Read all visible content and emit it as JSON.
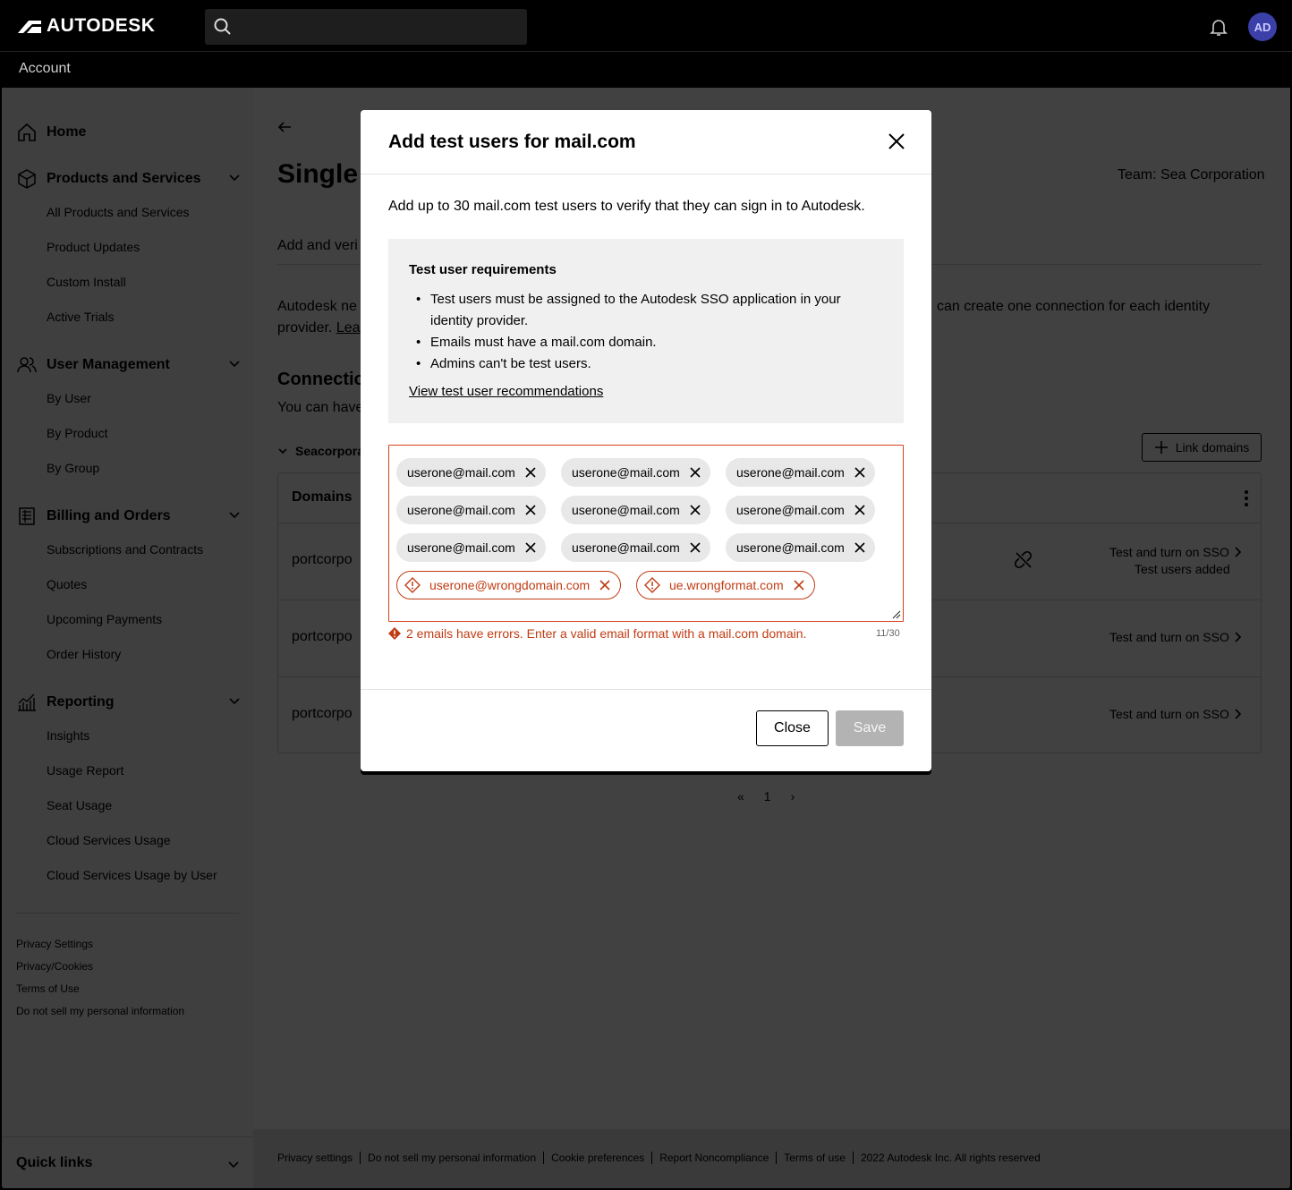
{
  "topbar": {
    "brand": "AUTODESK",
    "search_placeholder": "",
    "avatar_initials": "AD"
  },
  "subbar": {
    "title": "Account"
  },
  "sidebar": {
    "sections": [
      {
        "label": "Home",
        "icon": "home-icon",
        "items": []
      },
      {
        "label": "Products and Services",
        "icon": "box-icon",
        "items": [
          "All Products and Services",
          "Product Updates",
          "Custom Install",
          "Active Trials"
        ]
      },
      {
        "label": "User Management",
        "icon": "users-icon",
        "items": [
          "By User",
          "By Product",
          "By Group"
        ]
      },
      {
        "label": "Billing and Orders",
        "icon": "billing-icon",
        "items": [
          "Subscriptions and Contracts",
          "Quotes",
          "Upcoming Payments",
          "Order History"
        ]
      },
      {
        "label": "Reporting",
        "icon": "chart-icon",
        "items": [
          "Insights",
          "Usage Report",
          "Seat Usage",
          "Cloud Services Usage",
          "Cloud Services Usage by User"
        ]
      }
    ],
    "footer_links": [
      "Privacy Settings",
      "Privacy/Cookies",
      "Terms of Use",
      "Do not sell my personal information"
    ],
    "quick_links": "Quick links"
  },
  "page": {
    "title_partial": "Single",
    "team_label": "Team:",
    "team_name": "Sea Corporation",
    "subtitle_partial": "Add and veri",
    "desc_partial_1": "Autodesk ne",
    "desc_partial_2": "provider.",
    "learn_partial": "Lea",
    "desc_right": "can create one connection for each identity",
    "connections_partial": "Connectio",
    "you_can_partial": "You can have",
    "group_partial": "Seacorpora",
    "link_domains": "Link domains",
    "domains_header": "Domains",
    "rows": [
      {
        "domain": "portcorpo",
        "action": "Test and turn on SSO",
        "status": "Test users added"
      },
      {
        "domain": "portcorpo",
        "action": "Test and turn on SSO",
        "status": ""
      },
      {
        "domain": "portcorpo",
        "action": "Test and turn on SSO",
        "status": ""
      }
    ],
    "pagination_page": "1"
  },
  "footer": {
    "links": [
      "Privacy settings",
      "Do not sell my personal information",
      "Cookie preferences",
      "Report Noncompliance",
      "Terms of use",
      "2022 Autodesk Inc. All rights reserved"
    ]
  },
  "modal": {
    "title": "Add test users for mail.com",
    "intro": "Add up to 30 mail.com test users to verify that they can sign in to Autodesk.",
    "requirements": {
      "title": "Test user requirements",
      "items": [
        "Test users must be assigned to the Autodesk SSO application in your identity provider.",
        "Emails must have a mail.com domain.",
        "Admins can't be test users."
      ],
      "link": "View test user recommendations"
    },
    "chips": [
      "userone@mail.com",
      "userone@mail.com",
      "userone@mail.com",
      "userone@mail.com",
      "userone@mail.com",
      "userone@mail.com",
      "userone@mail.com",
      "userone@mail.com",
      "userone@mail.com"
    ],
    "error_chips": [
      "userone@wrongdomain.com",
      "ue.wrongformat.com"
    ],
    "error_message": "2 emails have errors. Enter a valid email format with a mail.com domain.",
    "counter": "11/30",
    "close_label": "Close",
    "save_label": "Save"
  },
  "colors": {
    "error": "#c13c13",
    "avatar": "#3b3fa8",
    "chip_bg": "#e8e8e8",
    "save_disabled": "#b3b3b3"
  }
}
